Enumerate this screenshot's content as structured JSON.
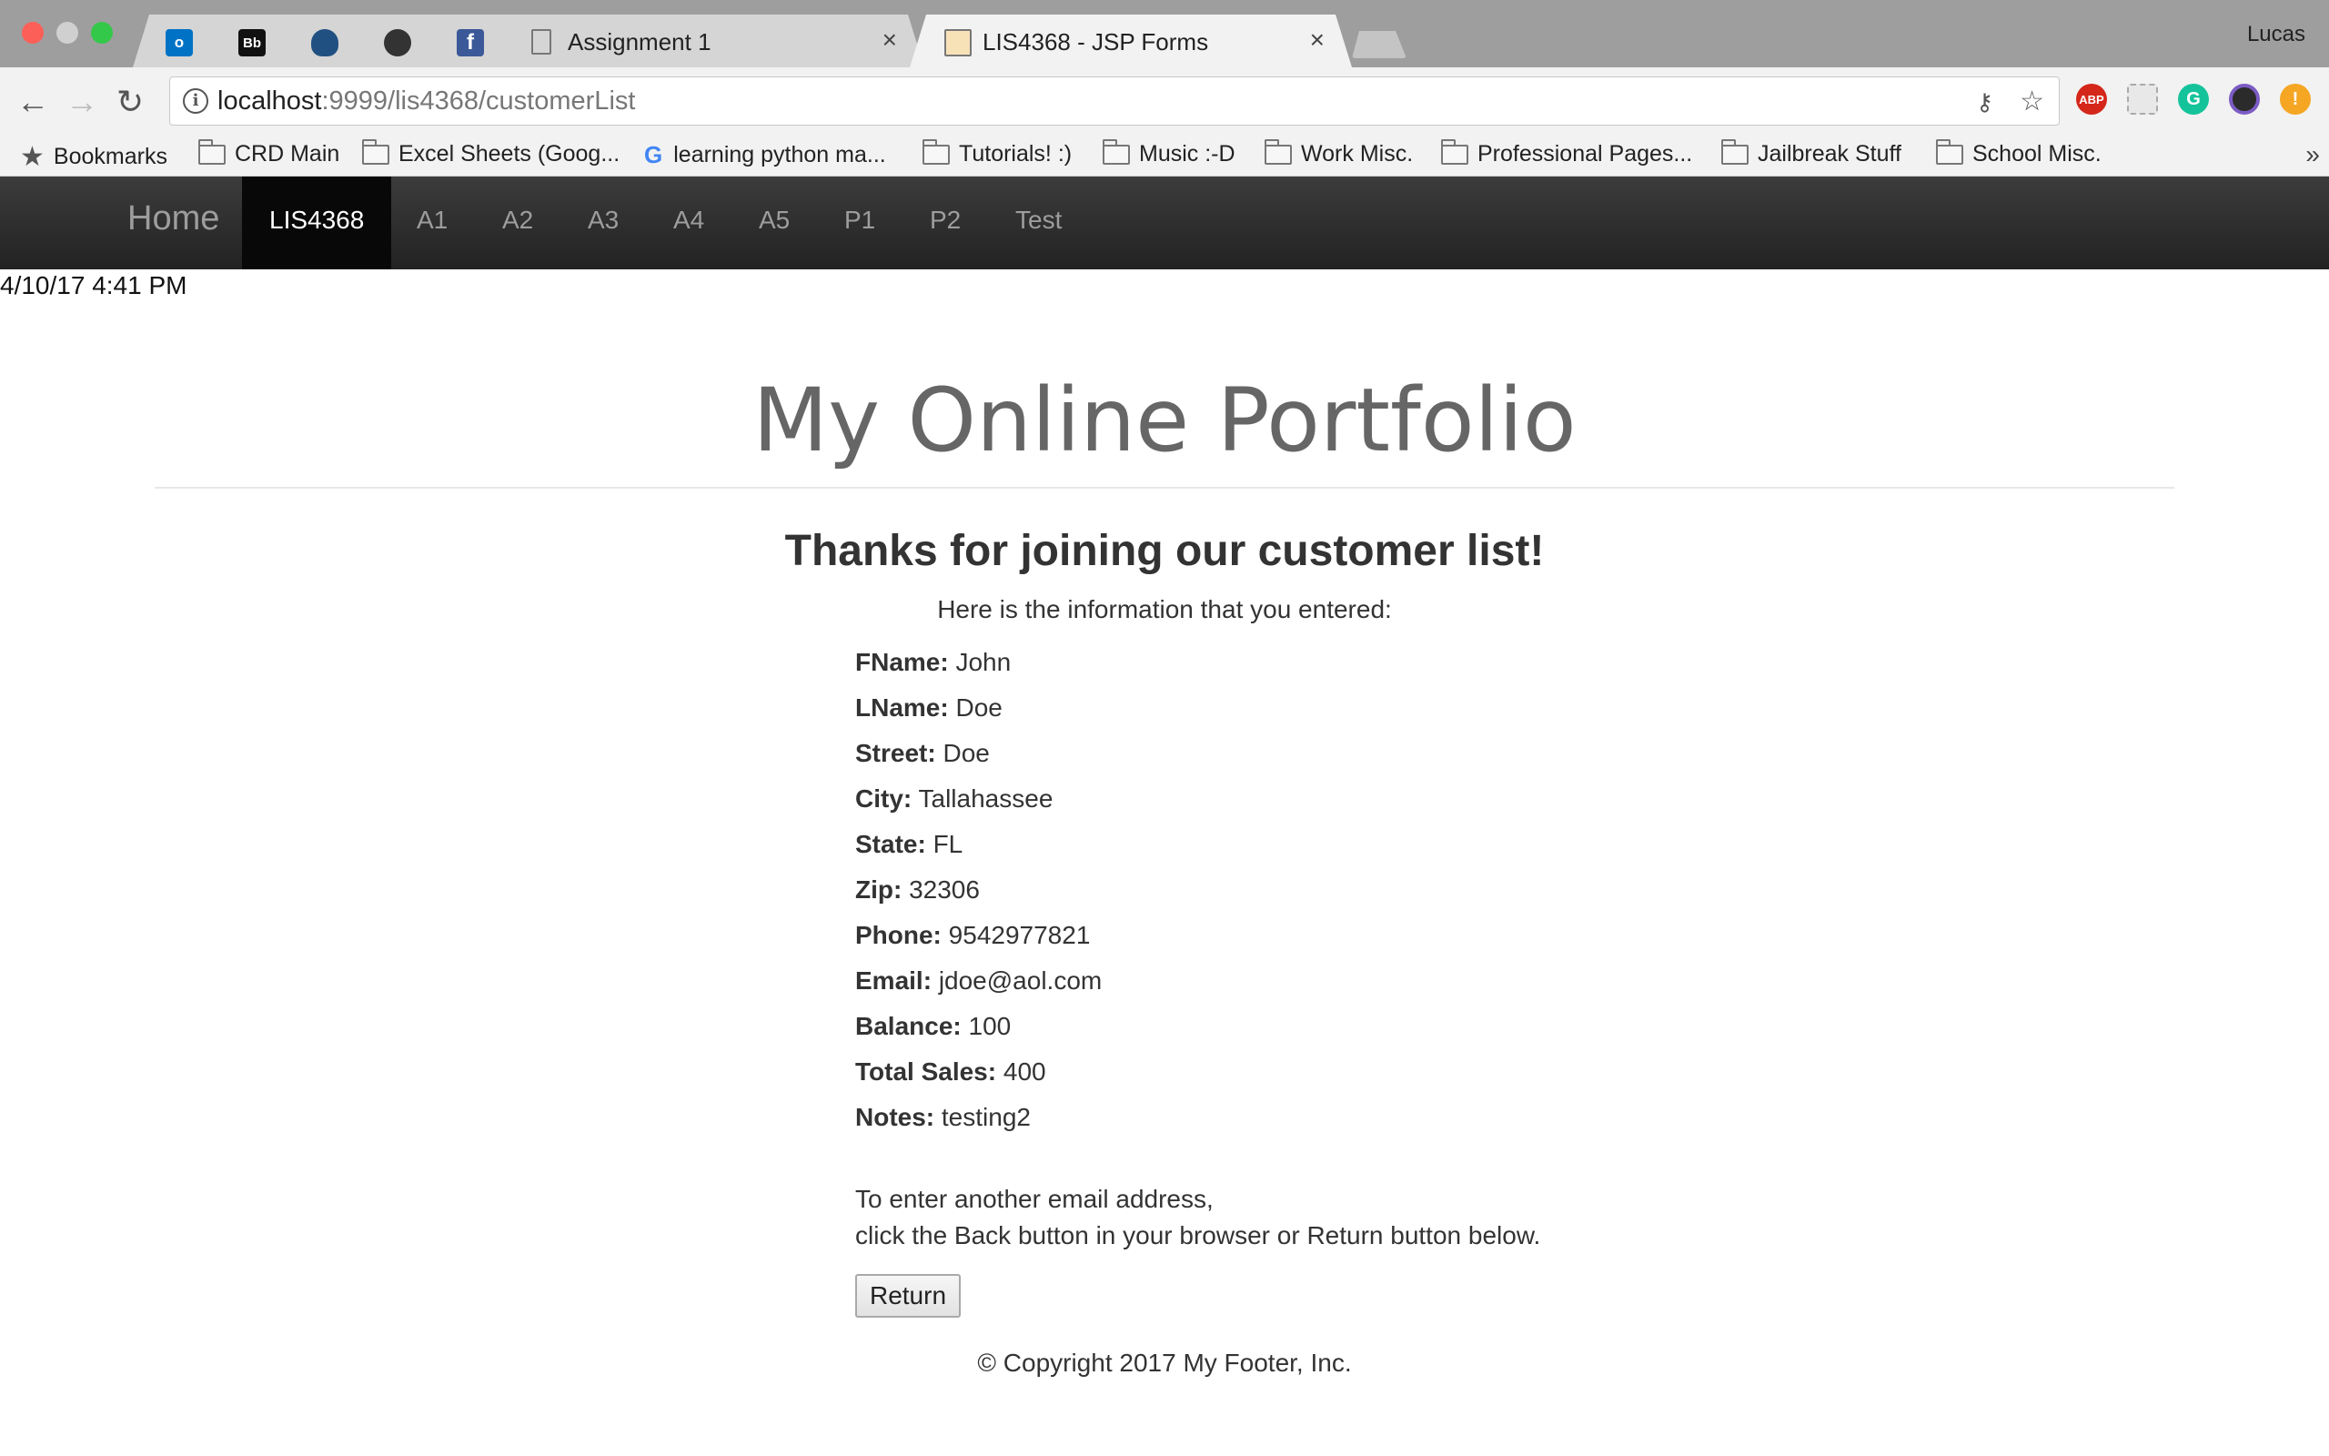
{
  "browser": {
    "profile_name": "Lucas",
    "tabs": [
      {
        "title": "",
        "icon": "outlook-icon"
      },
      {
        "title": "",
        "icon": "blackboard-icon",
        "icon_text": "Bb"
      },
      {
        "title": "",
        "icon": "bitbucket-icon"
      },
      {
        "title": "",
        "icon": "github-icon"
      },
      {
        "title": "",
        "icon": "facebook-icon",
        "icon_text": "f"
      },
      {
        "title": "Assignment 1",
        "icon": "document-icon"
      },
      {
        "title": "LIS4368 - JSP Forms",
        "icon": "tomcat-icon",
        "active": true
      }
    ],
    "url": {
      "host": "localhost",
      "path": ":9999/lis4368/customerList"
    },
    "extensions": [
      {
        "name": "adblock-plus-icon",
        "text": "ABP",
        "color": "#d4271a"
      },
      {
        "name": "puzzle-extension-icon",
        "text": "",
        "color": "#e0e0e0"
      },
      {
        "name": "grammarly-icon",
        "text": "G",
        "color": "#15c39a"
      },
      {
        "name": "camera-extension-icon",
        "text": "",
        "color": "#2b2b2b"
      },
      {
        "name": "alert-extension-icon",
        "text": "!",
        "color": "#f5a623"
      }
    ],
    "bookmarks": [
      {
        "label": "Bookmarks",
        "icon": "star-icon"
      },
      {
        "label": "CRD Main",
        "icon": "folder-icon"
      },
      {
        "label": "Excel Sheets (Goog...",
        "icon": "folder-icon"
      },
      {
        "label": "learning python ma...",
        "icon": "google-icon"
      },
      {
        "label": "Tutorials! :)",
        "icon": "folder-icon"
      },
      {
        "label": "Music :-D",
        "icon": "folder-icon"
      },
      {
        "label": "Work Misc.",
        "icon": "folder-icon"
      },
      {
        "label": "Professional Pages...",
        "icon": "folder-icon"
      },
      {
        "label": "Jailbreak Stuff",
        "icon": "folder-icon"
      },
      {
        "label": "School Misc.",
        "icon": "folder-icon"
      }
    ],
    "bookmarks_overflow": "»"
  },
  "navbar": {
    "brand": "Home",
    "links": [
      "LIS4368",
      "A1",
      "A2",
      "A3",
      "A4",
      "A5",
      "P1",
      "P2",
      "Test"
    ],
    "active": "LIS4368"
  },
  "page": {
    "timestamp": "4/10/17 4:41 PM",
    "title": "My Online Portfolio",
    "heading": "Thanks for joining our customer list!",
    "intro": "Here is the information that you entered:",
    "fields": [
      {
        "label": "FName:",
        "value": "John"
      },
      {
        "label": "LName:",
        "value": "Doe"
      },
      {
        "label": "Street:",
        "value": "Doe"
      },
      {
        "label": "City:",
        "value": "Tallahassee"
      },
      {
        "label": "State:",
        "value": "FL"
      },
      {
        "label": "Zip:",
        "value": "32306"
      },
      {
        "label": "Phone:",
        "value": "9542977821"
      },
      {
        "label": "Email:",
        "value": "jdoe@aol.com"
      },
      {
        "label": "Balance:",
        "value": "100"
      },
      {
        "label": "Total Sales:",
        "value": "400"
      },
      {
        "label": "Notes:",
        "value": "testing2"
      }
    ],
    "instructions_line1": "To enter another email address,",
    "instructions_line2": "click the Back button in your browser or Return button below.",
    "return_label": "Return",
    "footer": "© Copyright 2017 My Footer, Inc."
  },
  "colors": {
    "navbar_active": "#080808",
    "navbar_link": "#9d9d9d",
    "title_gray": "#666666"
  }
}
